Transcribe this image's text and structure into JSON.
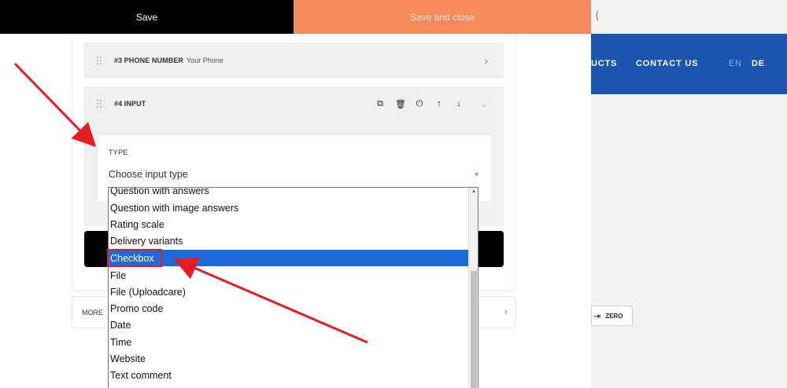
{
  "toolbar": {
    "save_label": "Save",
    "save_close_label": "Save and close"
  },
  "fields": [
    {
      "title": "#3 PHONE NUMBER",
      "subtitle": "Your Phone"
    },
    {
      "title": "#4 INPUT"
    }
  ],
  "type_section": {
    "label": "TYPE",
    "select_value": "Choose input type"
  },
  "dropdown": {
    "options": [
      "Question with answers",
      "Question with image answers",
      "Rating scale",
      "Delivery variants",
      "Checkbox",
      "File",
      "File (Uploadcare)",
      "Promo code",
      "Date",
      "Time",
      "Website",
      "Text comment"
    ],
    "selected": "Checkbox"
  },
  "more_label": "MORE",
  "site_nav": {
    "products": "UCTS",
    "contact": "CONTACT US",
    "lang_en": "EN",
    "lang_de": "DE"
  },
  "zero_label": "ZERO",
  "colors": {
    "save_bg": "#000000",
    "save_close_bg": "#f58a5b",
    "site_nav_bg": "#1c54b2",
    "selected_option_bg": "#1e6ad6",
    "annotation_red": "#e51c23"
  }
}
